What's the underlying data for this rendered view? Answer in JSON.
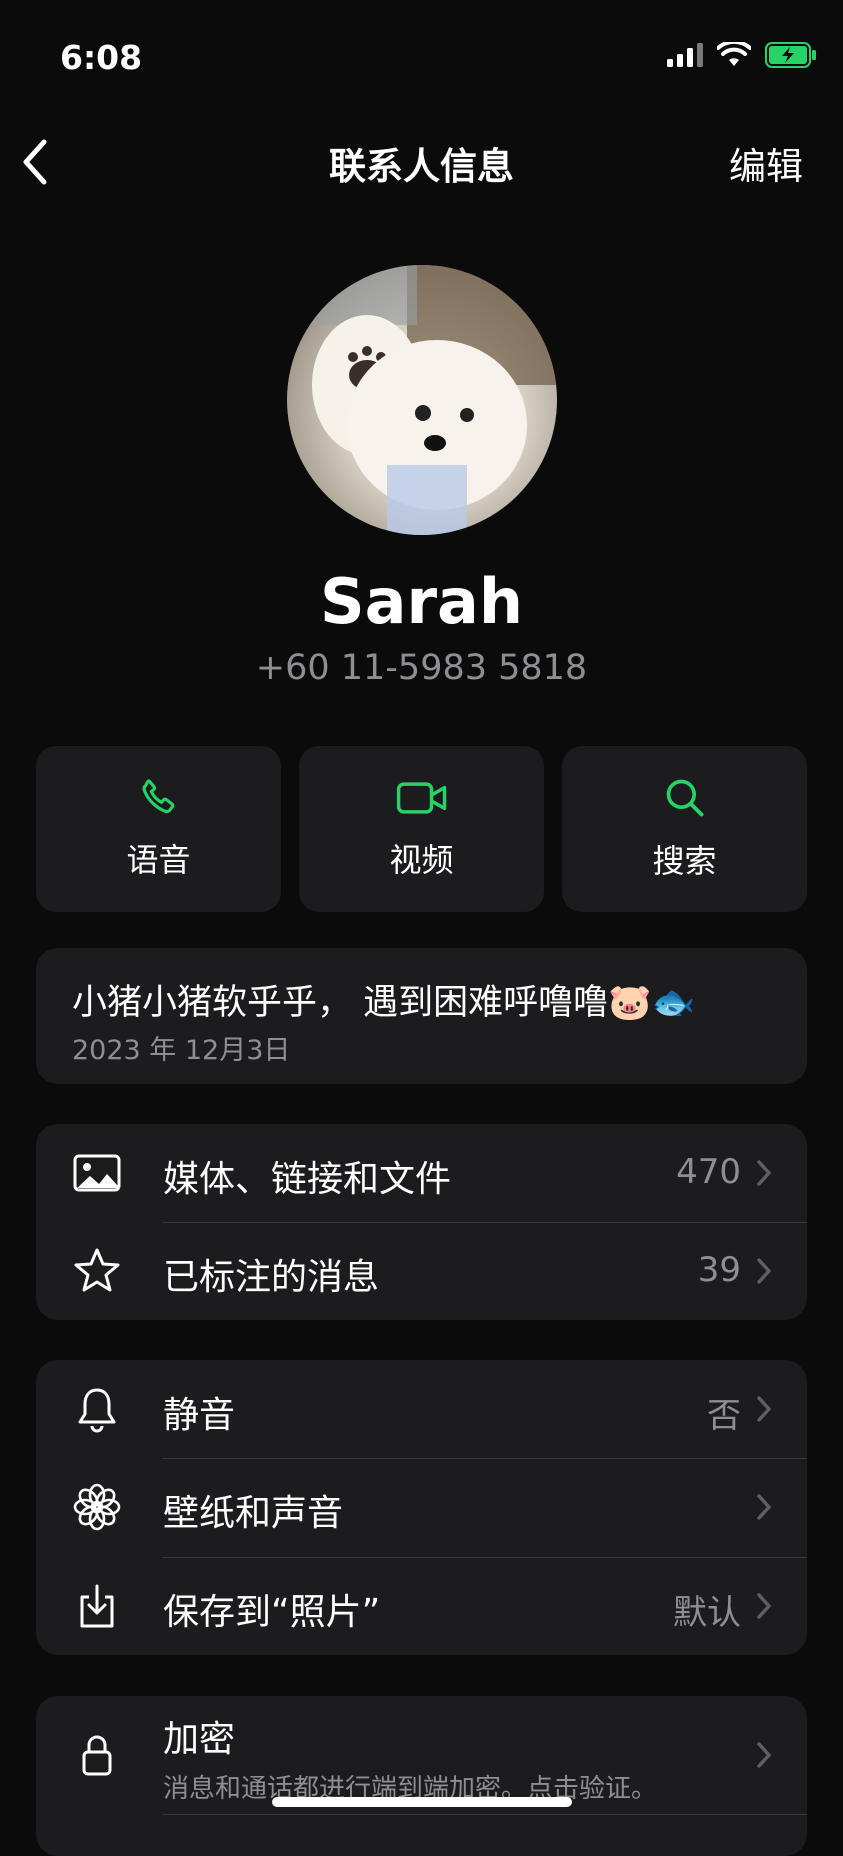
{
  "status": {
    "time": "6:08"
  },
  "nav": {
    "title": "联系人信息",
    "edit": "编辑"
  },
  "contact": {
    "name": "Sarah",
    "phone": "+60 11-5983 5818"
  },
  "actions": [
    {
      "label": "语音",
      "icon": "phone-icon"
    },
    {
      "label": "视频",
      "icon": "video-icon"
    },
    {
      "label": "搜索",
      "icon": "search-icon"
    }
  ],
  "about": {
    "text": "小猪小猪软乎乎， 遇到困难呼噜噜🐷🐟",
    "date": "2023 年 12月3日"
  },
  "media_section": {
    "items": [
      {
        "label": "媒体、链接和文件",
        "value": "470",
        "icon": "photo-icon"
      },
      {
        "label": "已标注的消息",
        "value": "39",
        "icon": "star-icon"
      }
    ]
  },
  "settings_section": {
    "items": [
      {
        "label": "静音",
        "value": "否",
        "icon": "bell-icon"
      },
      {
        "label": "壁纸和声音",
        "value": "",
        "icon": "flower-icon"
      },
      {
        "label": "保存到“照片”",
        "value": "默认",
        "icon": "save-icon"
      }
    ]
  },
  "encryption": {
    "label": "加密",
    "subtitle": "消息和通话都进行端到端加密。点击验证。",
    "icon": "lock-icon"
  },
  "colors": {
    "accent": "#25d366",
    "background": "#0b0b0c",
    "card": "#1c1c1e",
    "secondary_text": "#8e8e93"
  }
}
